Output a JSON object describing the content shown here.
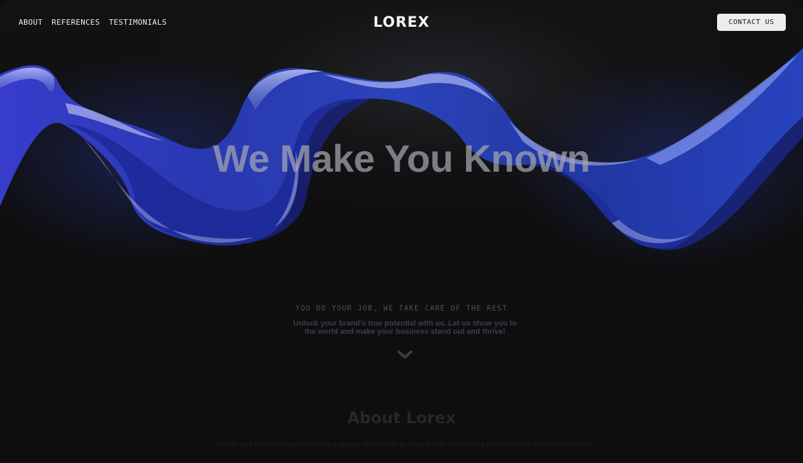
{
  "nav": {
    "about": "ABOUT",
    "references": "REFERENCES",
    "testimonials": "TESTIMONIALS"
  },
  "logo": "LOREX",
  "contact_button": "CONTACT US",
  "hero": {
    "title": "We Make You Known",
    "tagline": "YOU DO YOUR JOB, WE TAKE CARE OF THE REST",
    "subtitle": "Unlock your brand's true potential with us. Let us show you to the world and make your business stand out and thrive!",
    "scroll_icon": "chevron-down-icon"
  },
  "about": {
    "title": "About Lorex",
    "text": "We are your dedicated digital marketing agency, focused on growing brands and making every business known to the world."
  },
  "colors": {
    "background": "#0e0e0f",
    "ribbon_blue": "#2a3fc4",
    "button_bg": "#ededed",
    "nav_text": "#f2f2f2"
  }
}
